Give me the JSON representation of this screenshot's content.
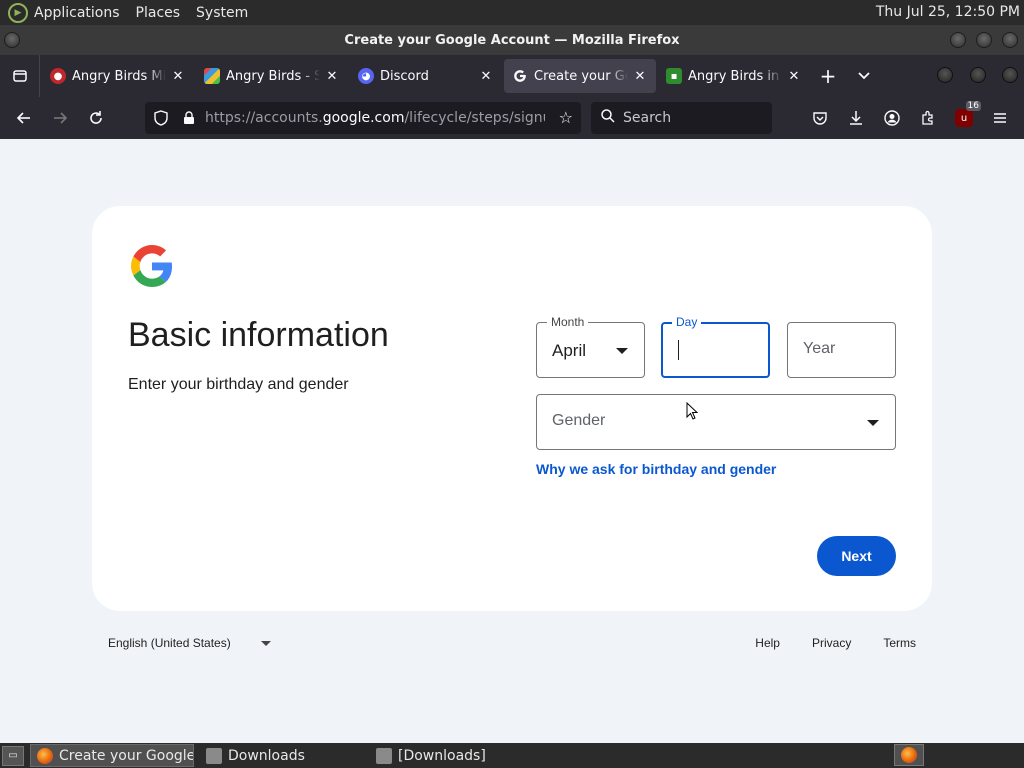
{
  "system_panel": {
    "menus": [
      "Applications",
      "Places",
      "System"
    ],
    "clock": "Thu Jul 25, 12:50 PM"
  },
  "window": {
    "title": "Create your Google Account — Mozilla Firefox"
  },
  "tabs": [
    {
      "title": "Angry Birds Mini",
      "favicon_color": "#c0262d",
      "active": false
    },
    {
      "title": "Angry Birds - Sh",
      "favicon_color": "#3b9be0",
      "active": false
    },
    {
      "title": "Discord",
      "favicon_color": "#5865f2",
      "active": false
    },
    {
      "title": "Create your Google",
      "favicon_color": "#ffffff",
      "active": true
    },
    {
      "title": "Angry Birds in Mi",
      "favicon_color": "#2e8b2e",
      "active": false
    }
  ],
  "navbar": {
    "url_prefix": "https://accounts.",
    "url_domain": "google.com",
    "url_rest": "/lifecycle/steps/signup/ba",
    "search_placeholder": "Search",
    "ublock_count": "16"
  },
  "page": {
    "heading": "Basic information",
    "subheading": "Enter your birthday and gender",
    "month": {
      "label": "Month",
      "value": "April"
    },
    "day": {
      "label": "Day",
      "value": ""
    },
    "year": {
      "placeholder": "Year"
    },
    "gender": {
      "placeholder": "Gender"
    },
    "why_link": "Why we ask for birthday and gender",
    "next_button": "Next",
    "accent_color": "#0b57d0"
  },
  "footer": {
    "language": "English (United States)",
    "links": [
      "Help",
      "Privacy",
      "Terms"
    ]
  },
  "taskbar": {
    "items": [
      {
        "label": "Create your Google ...",
        "icon": "firefox-icon",
        "active": true
      },
      {
        "label": "Downloads",
        "icon": "folder-icon",
        "active": false
      },
      {
        "label": "[Downloads]",
        "icon": "folder-icon",
        "active": false
      }
    ]
  }
}
